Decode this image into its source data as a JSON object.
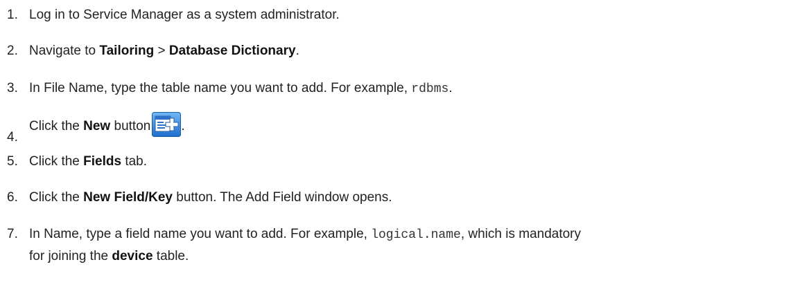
{
  "steps": [
    {
      "num": "1.",
      "text": "Log in to Service Manager as a system administrator."
    },
    {
      "num": "2.",
      "pre": "Navigate to ",
      "b1": "Tailoring",
      "mid": " > ",
      "b2": "Database Dictionary",
      "post": "."
    },
    {
      "num": "3.",
      "pre": "In File Name, type the table name you want to add. For example, ",
      "code": "rdbms",
      "post": "."
    },
    {
      "num": "4.",
      "pre": "Click the ",
      "b1": "New",
      "mid": " button",
      "post": ".",
      "icon": "new-record-icon"
    },
    {
      "num": "5.",
      "pre": "Click the ",
      "b1": "Fields",
      "post": " tab."
    },
    {
      "num": "6.",
      "pre": "Click the ",
      "b1": "New Field/Key",
      "post": " button. The Add Field window opens."
    },
    {
      "num": "7.",
      "pre": "In Name, type a field name you want to add. For example, ",
      "code": "logical.name",
      "post": ", which is mandatory",
      "line2_pre": "for joining the ",
      "line2_b": "device",
      "line2_post": " table."
    }
  ]
}
